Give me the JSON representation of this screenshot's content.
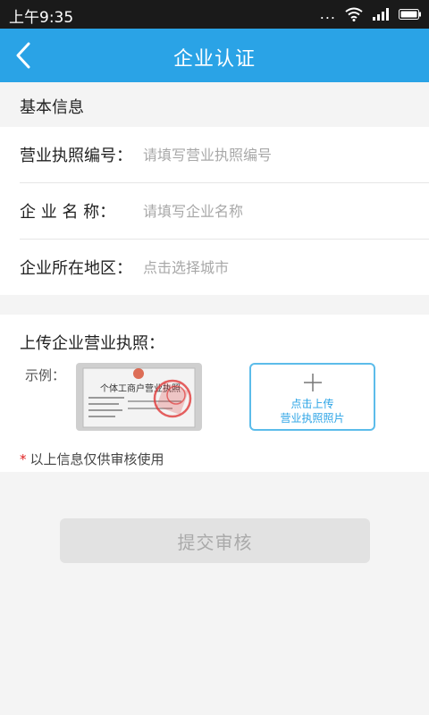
{
  "status_bar": {
    "time": "上午9:35",
    "dots": "...",
    "icons": [
      "wifi-icon",
      "signal-icon",
      "battery-icon"
    ]
  },
  "header": {
    "title": "企业认证",
    "back_icon": "chevron-left-icon"
  },
  "basic_info": {
    "section_title": "基本信息",
    "fields": [
      {
        "label": "营业执照编号：",
        "placeholder": "请填写营业执照编号",
        "value": ""
      },
      {
        "label": "企 业 名 称：",
        "placeholder": "请填写企业名称",
        "value": ""
      },
      {
        "label": "企业所在地区：",
        "placeholder": "点击选择城市",
        "value": ""
      }
    ]
  },
  "upload": {
    "title": "上传企业营业执照：",
    "example_label": "示例：",
    "sample_image_text": "个体工商户营业执照",
    "button_line1": "点击上传",
    "button_line2": "营业执照照片",
    "button_icon": "plus-icon"
  },
  "note": {
    "star": "*",
    "text": "以上信息仅供审核使用"
  },
  "submit": {
    "label": "提交审核"
  },
  "colors": {
    "header": "#2aa3e6",
    "status_bar": "#1a1a1a",
    "accent": "#5cbcea",
    "required_star": "#e02020",
    "disabled_button": "#e2e2e2"
  }
}
